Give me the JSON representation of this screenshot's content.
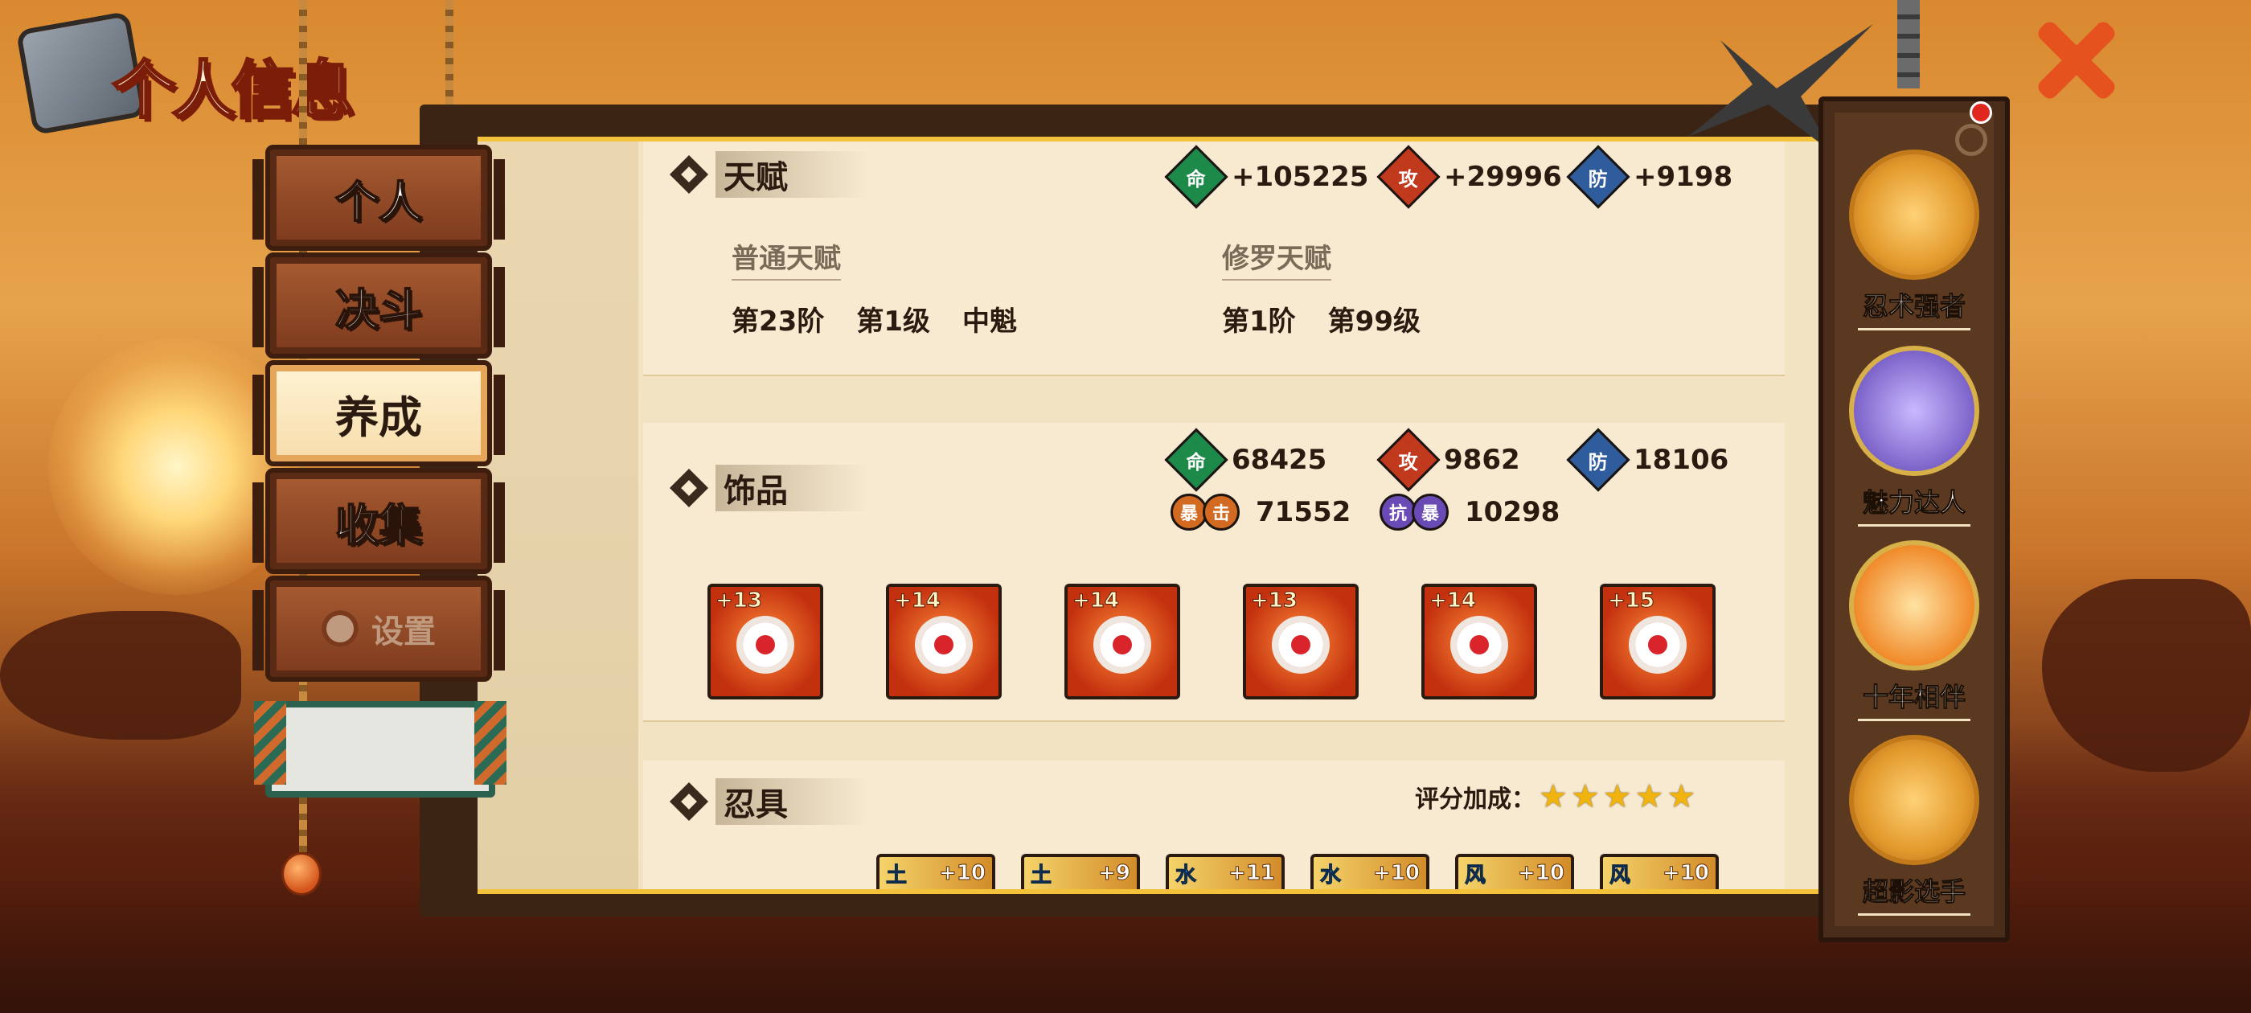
{
  "window": {
    "title": "个人信息"
  },
  "nav_tabs": [
    {
      "label": "个人",
      "active": false
    },
    {
      "label": "决斗",
      "active": false
    },
    {
      "label": "养成",
      "active": true
    },
    {
      "label": "收集",
      "active": false
    },
    {
      "label": "设置",
      "active": false,
      "disabled": true,
      "icon": "gear-icon"
    }
  ],
  "talent": {
    "title": "天赋",
    "stats": [
      {
        "icon": "命",
        "value": "+105225",
        "color": "#1e8a4a"
      },
      {
        "icon": "攻",
        "value": "+29996",
        "color": "#c23a1e"
      },
      {
        "icon": "防",
        "value": "+9198",
        "color": "#2f5c9c"
      }
    ],
    "normal": {
      "title": "普通天赋",
      "tier": "第23阶",
      "level": "第1级",
      "rank": "中魁"
    },
    "asura": {
      "title": "修罗天赋",
      "tier": "第1阶",
      "level": "第99级"
    }
  },
  "accessory": {
    "title": "饰品",
    "stats": [
      {
        "icon": "命",
        "value": "68425",
        "color": "#1e8a4a"
      },
      {
        "icon": "攻",
        "value": "9862",
        "color": "#c23a1e"
      },
      {
        "icon": "防",
        "value": "18106",
        "color": "#2f5c9c"
      }
    ],
    "stats2": [
      {
        "icon1": "暴",
        "icon2": "击",
        "value": "71552"
      },
      {
        "icon1": "抗",
        "icon2": "暴",
        "value": "10298"
      }
    ],
    "items": [
      "+13",
      "+14",
      "+14",
      "+13",
      "+14",
      "+15"
    ]
  },
  "ninja_tools": {
    "title": "忍具",
    "rating_label": "评分加成：",
    "stars": 5,
    "tools": [
      {
        "elem": "土",
        "plus": "+10"
      },
      {
        "elem": "土",
        "plus": "+9"
      },
      {
        "elem": "水",
        "plus": "+11"
      },
      {
        "elem": "水",
        "plus": "+10"
      },
      {
        "elem": "风",
        "plus": "+10"
      },
      {
        "elem": "风",
        "plus": "+10"
      }
    ]
  },
  "achievements": [
    {
      "label": "忍术强者",
      "icon": "ninjutsu-medal-icon"
    },
    {
      "label": "魅力达人",
      "icon": "charm-avatar-icon"
    },
    {
      "label": "十年相伴",
      "icon": "ten-years-avatar-icon"
    },
    {
      "label": "超影选手",
      "icon": "super-kage-medal-icon"
    }
  ]
}
